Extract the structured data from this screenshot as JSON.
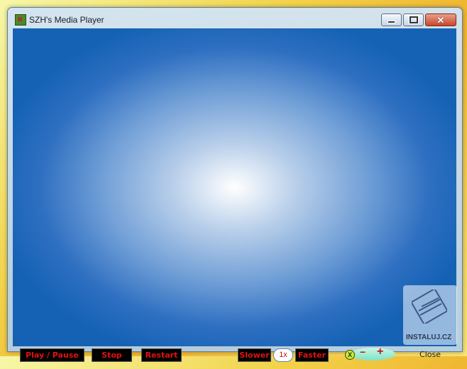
{
  "window": {
    "title": "SZH's Media Player",
    "caption_buttons": {
      "close_glyph": "✕"
    }
  },
  "controls": {
    "play_pause": "Play / Pause",
    "stop": "Stop",
    "restart": "Restart",
    "slower": "Slower",
    "speed": "1x",
    "faster": "Faster",
    "mute": "X",
    "vol_minus": "−",
    "vol_plus": "+",
    "close": "Close"
  },
  "watermark": {
    "text": "INSTALUJ.CZ"
  },
  "colors": {
    "accent": "#1562b5",
    "button_text": "#e01212"
  }
}
